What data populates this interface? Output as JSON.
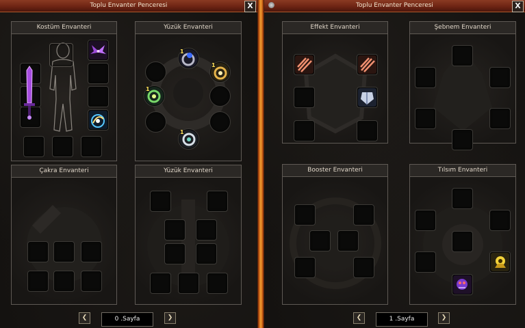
{
  "left_window": {
    "title": "Toplu Envanter Penceresi",
    "close_label": "X",
    "panels": {
      "costume": "Kostüm Envanteri",
      "ring_top": "Yüzük Envanteri",
      "chakra": "Çakra Envanteri",
      "ring_bottom": "Yüzük Envanteri"
    },
    "ring_badges": [
      "1",
      "1",
      "1",
      "1"
    ],
    "pager": {
      "prev_icon": "chevron-left-icon",
      "page_label": "0 .Sayfa",
      "next_icon": "chevron-right-icon"
    }
  },
  "right_window": {
    "title": "Toplu Envanter Penceresi",
    "close_label": "X",
    "panels": {
      "effect": "Effekt Envanteri",
      "dew": "Şebnem Envanteri",
      "booster": "Booster Envanteri",
      "talisman": "Tılsım Envanteri"
    },
    "pager": {
      "prev_icon": "chevron-left-icon",
      "page_label": "1 .Sayfa",
      "next_icon": "chevron-right-icon"
    }
  },
  "colors": {
    "title_bar": "#6e2414",
    "divider_glow": "#f0a032",
    "badge_text": "#ffe15a"
  }
}
